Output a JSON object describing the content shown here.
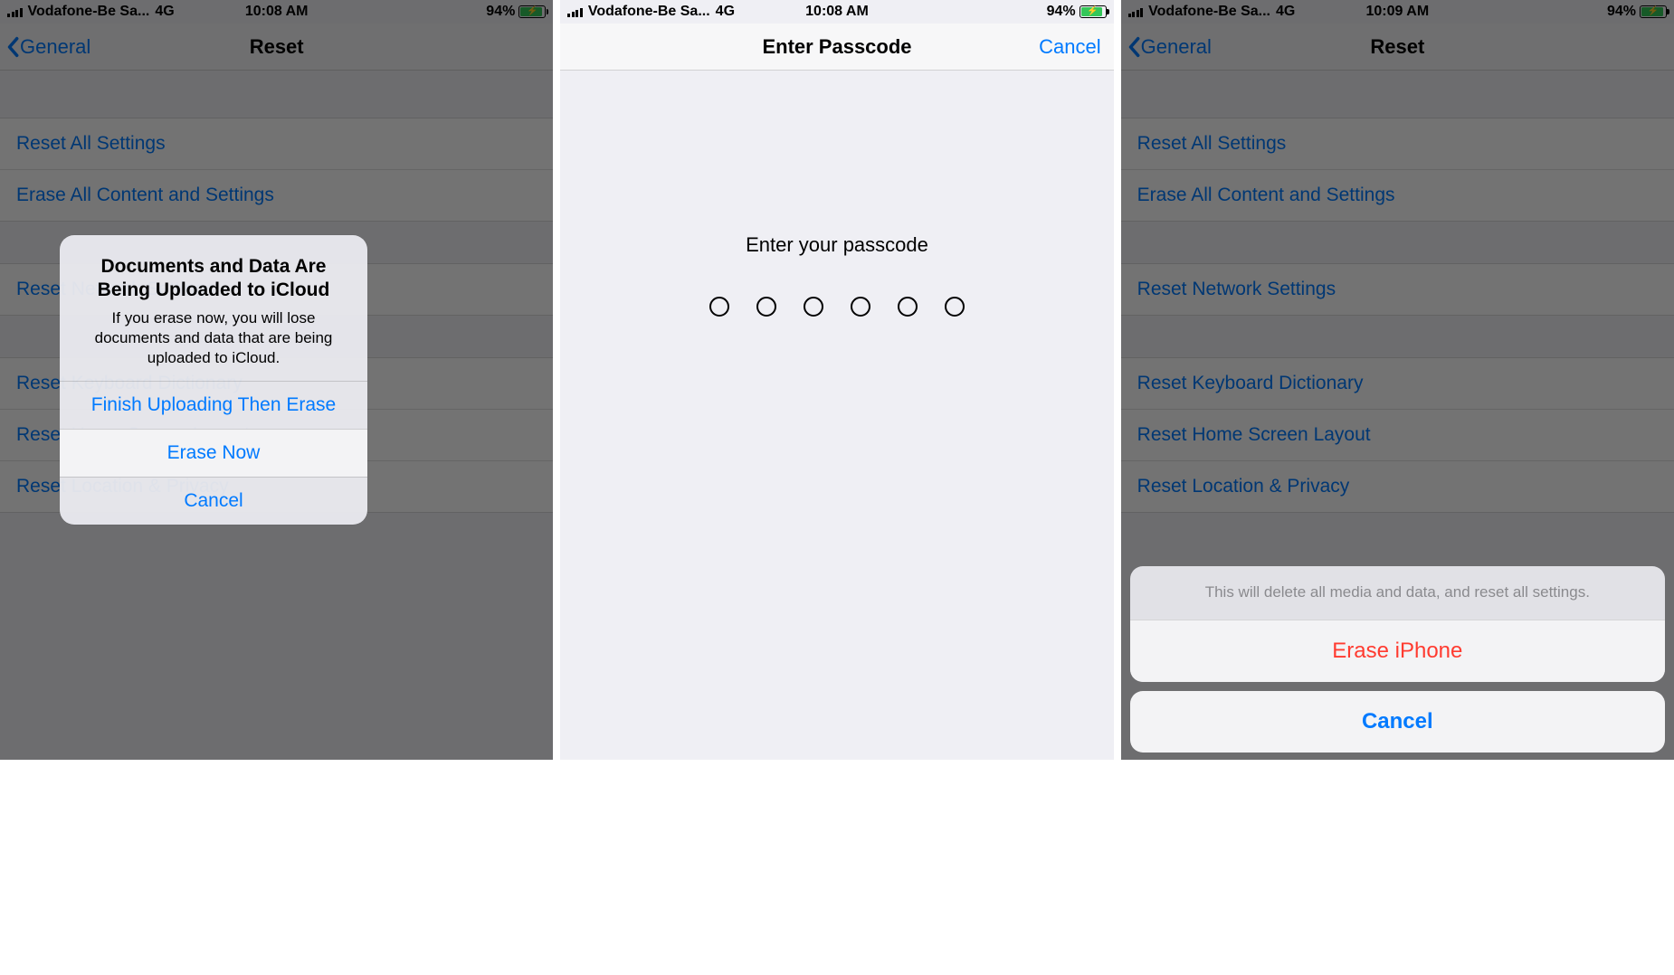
{
  "status": {
    "carrier": "Vodafone-Be Sa...",
    "network": "4G",
    "time_a": "10:08 AM",
    "time_b": "10:09 AM",
    "battery_pct": "94%"
  },
  "screen1": {
    "nav_back": "General",
    "nav_title": "Reset",
    "items": {
      "reset_all": "Reset All Settings",
      "erase_all": "Erase All Content and Settings",
      "reset_network": "Reset Network Settings",
      "reset_keyboard": "Reset Keyboard Dictionary",
      "reset_home": "Reset Home Screen Layout",
      "reset_location": "Reset Location & Privacy"
    },
    "alert": {
      "title": "Documents and Data Are Being Uploaded to iCloud",
      "message": "If you erase now, you will lose documents and data that are being uploaded to iCloud.",
      "opt_finish": "Finish Uploading Then Erase",
      "opt_erase": "Erase Now",
      "opt_cancel": "Cancel"
    }
  },
  "screen2": {
    "nav_title": "Enter Passcode",
    "nav_cancel": "Cancel",
    "prompt": "Enter your passcode"
  },
  "screen3": {
    "nav_back": "General",
    "nav_title": "Reset",
    "items": {
      "reset_all": "Reset All Settings",
      "erase_all": "Erase All Content and Settings",
      "reset_network": "Reset Network Settings",
      "reset_keyboard": "Reset Keyboard Dictionary",
      "reset_home": "Reset Home Screen Layout",
      "reset_location": "Reset Location & Privacy"
    },
    "sheet": {
      "message": "This will delete all media and data, and reset all settings.",
      "erase": "Erase iPhone",
      "cancel": "Cancel"
    }
  }
}
